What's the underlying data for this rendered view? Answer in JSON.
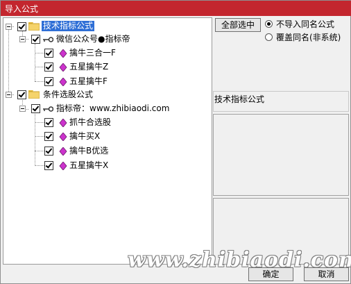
{
  "window": {
    "title": "导入公式"
  },
  "tree": {
    "groups": [
      {
        "label": "技术指标公式",
        "selected": true,
        "children": [
          {
            "label": "微信公众号●指标帝",
            "children": [
              {
                "label": "擒牛三合一F"
              },
              {
                "label": "五星擒牛Z"
              },
              {
                "label": "五星擒牛F"
              }
            ]
          }
        ]
      },
      {
        "label": "条件选股公式",
        "selected": false,
        "children": [
          {
            "label": "指标帝：www.zhibiaodi.com",
            "children": [
              {
                "label": "抓牛合选股"
              },
              {
                "label": "擒牛买X"
              },
              {
                "label": "擒牛B优选"
              },
              {
                "label": "五星擒牛X"
              }
            ]
          }
        ]
      }
    ]
  },
  "options": {
    "select_all_label": "全部选中",
    "radio_skip_label": "不导入同名公式",
    "radio_overwrite_label": "覆盖同名(非系统)",
    "selected_option": "skip"
  },
  "info_panel": {
    "title": "技术指标公式"
  },
  "footer": {
    "ok_label": "确定",
    "cancel_label": "取消"
  },
  "watermark": "www.zhibiaodi.com",
  "colors": {
    "titlebar": "#c3262e",
    "selection": "#2f6fd6",
    "gem": "#cc33cc"
  }
}
